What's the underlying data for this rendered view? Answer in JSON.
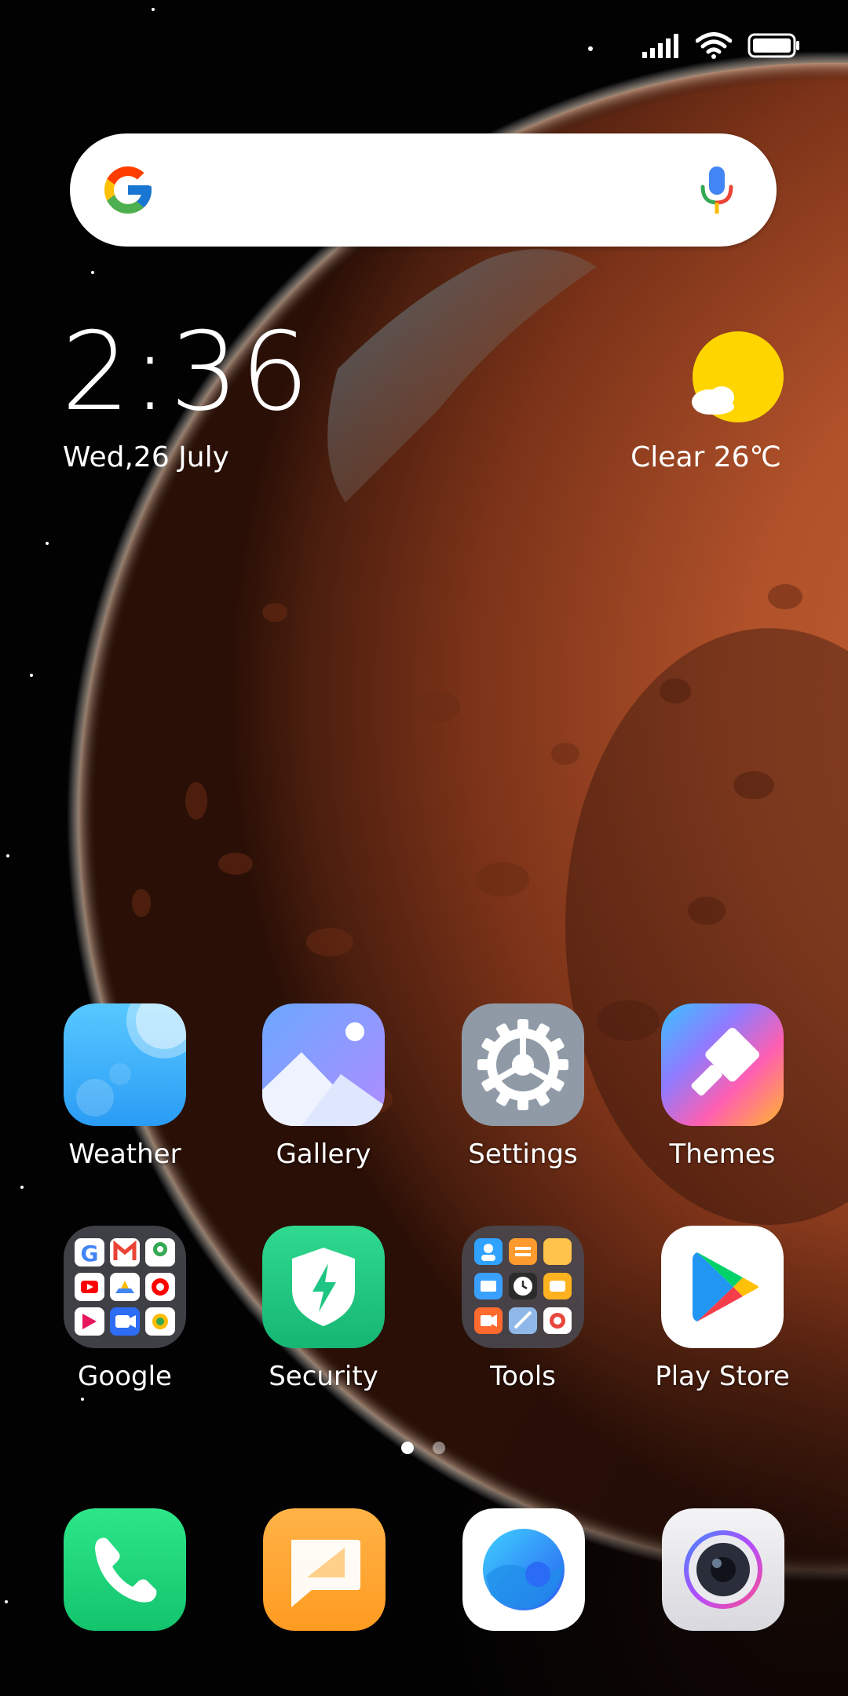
{
  "status_bar": {
    "signal_icon": "signal-icon",
    "wifi_icon": "wifi-icon",
    "battery_icon": "battery-icon"
  },
  "search": {
    "logo_icon": "google-logo-icon",
    "mic_icon": "mic-icon",
    "placeholder": ""
  },
  "clock": {
    "time": "2:36",
    "date": "Wed,26 July"
  },
  "weather": {
    "icon": "sun-cloud-icon",
    "text": "Clear 26℃"
  },
  "apps": [
    {
      "label": "Weather",
      "icon": "weather-app-icon"
    },
    {
      "label": "Gallery",
      "icon": "gallery-app-icon"
    },
    {
      "label": "Settings",
      "icon": "settings-app-icon"
    },
    {
      "label": "Themes",
      "icon": "themes-app-icon"
    },
    {
      "label": "Google",
      "icon": "google-folder-icon"
    },
    {
      "label": "Security",
      "icon": "security-app-icon"
    },
    {
      "label": "Tools",
      "icon": "tools-folder-icon"
    },
    {
      "label": "Play Store",
      "icon": "play-store-app-icon"
    }
  ],
  "page_indicator": {
    "pages": 2,
    "active": 1
  },
  "dock": [
    {
      "icon": "phone-app-icon"
    },
    {
      "icon": "messages-app-icon"
    },
    {
      "icon": "browser-app-icon"
    },
    {
      "icon": "camera-app-icon"
    }
  ],
  "colors": {
    "mars": "#b5522a",
    "space": "#020203",
    "sun": "#ffd500"
  }
}
